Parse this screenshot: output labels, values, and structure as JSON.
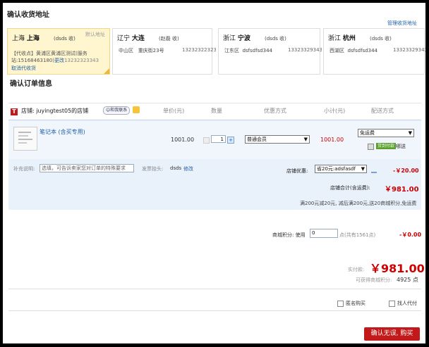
{
  "page": {
    "title": "确认收货地址",
    "manage_link": "管理收货地址",
    "order_title": "确认订单信息"
  },
  "addresses": [
    {
      "province": "上海",
      "city": "上海",
      "receiver": "(dsds 收)",
      "default_label": "默认地址",
      "line1": "【代收点】黄浦区黄浦区测试(服务",
      "line2": "站:15168463180)",
      "change": "更改",
      "phone": "13232323343",
      "cancel": "取消代收货"
    },
    {
      "province": "辽宁",
      "city": "大连",
      "receiver": "(赵磊 收)",
      "district": "中山区",
      "street": "重庆街23号",
      "phone": "13232322323"
    },
    {
      "province": "浙江",
      "city": "宁波",
      "receiver": "(dsds 收)",
      "district": "江东区",
      "street": "dsfsdfsd344",
      "phone": "13323329343"
    },
    {
      "province": "浙江",
      "city": "杭州",
      "receiver": "(dsds 收)",
      "district": "西湖区",
      "street": "dsfsdfsd344",
      "phone": "13323329343"
    }
  ],
  "table_headers": {
    "unit_price": "单价(元)",
    "quantity": "数量",
    "discount": "优惠方式",
    "subtotal": "小计(元)",
    "shipping": "配送方式"
  },
  "shop": {
    "label": "店铺: juyingtest05的店铺",
    "contact_badge": "和我联系"
  },
  "item": {
    "name": "笔记本 (含买专用)",
    "price": "1001.00",
    "qty": "1",
    "discount": "普通会员",
    "subtotal": "1001.00",
    "shipping": "免运费",
    "badge": "货到付款",
    "badge2": "哪送"
  },
  "note": {
    "label": "补充说明:",
    "placeholder": "选填，可告诉卖家您对订单的特殊要求",
    "invoice_label": "发票抬头:",
    "invoice_value": "dsds",
    "invoice_edit": "修改"
  },
  "shop_discount": {
    "label": "店铺优惠:",
    "select": "省20元:adsfasdf",
    "amount": "-￥20.00"
  },
  "shop_total": {
    "label": "店铺合计(含运费):",
    "amount": "￥981.00"
  },
  "promo_note": "满200元减20元, 减后满200元,送20商城积分,免运费",
  "points": {
    "label": "商城积分: 使用",
    "value": "0",
    "suffix": "点(共有1561点)",
    "amount": "-￥0.00"
  },
  "payable": {
    "label": "实付款:",
    "amount": "￥981.00"
  },
  "earn_points": {
    "label": "可获得商城积分:",
    "value": "4925 点"
  },
  "options": {
    "anonymous": "匿名购买",
    "proxy": "找人代付"
  },
  "submit": "确认无误, 购买",
  "colors": {
    "accent": "#c21a1a",
    "link": "#1f5fa8",
    "selected_bg": "#fff6cf",
    "panel_bg": "#e9f1fb"
  }
}
